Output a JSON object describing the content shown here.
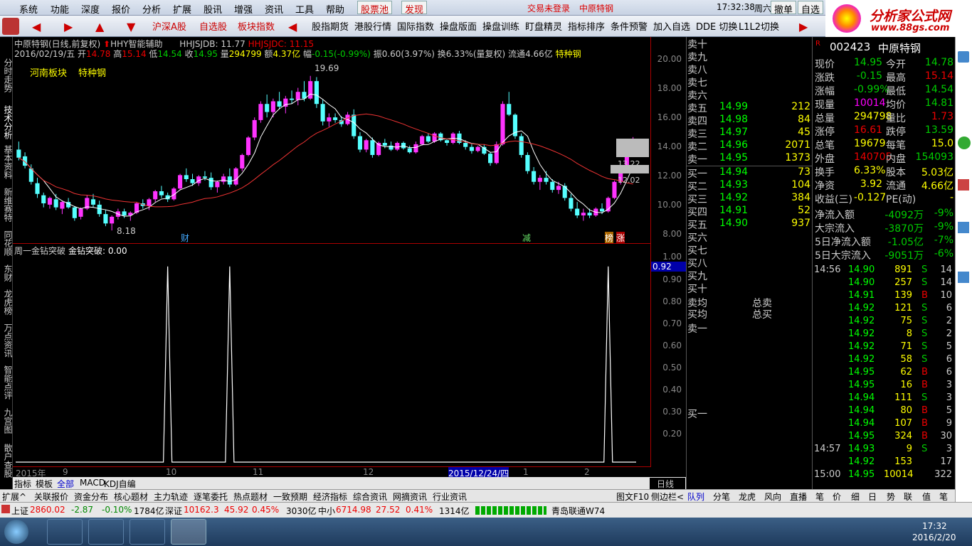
{
  "menu": {
    "items": [
      "系统",
      "功能",
      "深度",
      "报价",
      "分析",
      "扩展",
      "股讯",
      "增强",
      "资讯",
      "工具",
      "帮助"
    ],
    "stockpool": "股票池",
    "discover": "发现",
    "trade_status": "交易未登录",
    "stock_name": "中原特钢",
    "clock": "17:32:38",
    "weekday": "周六",
    "cancel": "撤单",
    "selfsel": "自选"
  },
  "toolbar": {
    "items": [
      "沪深A股",
      "自选股",
      "板块指数",
      "股指期货",
      "港股行情",
      "国际指数",
      "操盘版面",
      "操盘训练",
      "盯盘精灵",
      "指标排序",
      "条件预警",
      "加入自选",
      "DDE 切换",
      "L1L2切换"
    ]
  },
  "logo": {
    "title": "分析家公式网",
    "url": "www.88gs.com"
  },
  "leftbar": {
    "tabs": [
      "分时走势",
      "技术分析",
      "基本资料",
      "新维赛特",
      "同花顺",
      "东财",
      "龙虎榜",
      "万点资讯",
      "智能点评",
      "九宫图",
      "散户查股"
    ]
  },
  "chart": {
    "title": "中原特钢(日线,前复权)",
    "tool": "HHY智能辅助",
    "line1": "2016/02/19/五",
    "ohlc": {
      "open": "14.78",
      "high": "15.14",
      "low": "14.54",
      "close": "14.95",
      "vol": "294799",
      "amt": "4.37亿",
      "chg": "-0.15(-0.99%)",
      "amp": "0.60(3.97%)",
      "turnover": "6.33%(量复权)",
      "float": "4.66亿",
      "sector_short": "特种钢"
    },
    "hhjsjdb": "HHJSJDB: 11.77",
    "hhjsjdc": "HHJSJDC: 11.15",
    "board": "河南板块",
    "industry": "特种钢",
    "high_label": "19.69",
    "low_label": "8.18",
    "badge_cai": "财",
    "badge_jian": "减",
    "badge_bang": "榜",
    "badge_zhang": "涨",
    "price_box1": "13.22",
    "price_box2": "12.02",
    "price_axis": [
      "20.00",
      "18.00",
      "16.00",
      "14.00",
      "12.00",
      "10.00",
      "8.00"
    ]
  },
  "chart_data": {
    "type": "candlestick",
    "title": "中原特钢(日线,前复权)",
    "ylim": [
      7.5,
      21
    ],
    "candles": [
      [
        14.2,
        14.8,
        13.4,
        13.6
      ],
      [
        13.7,
        14.0,
        12.8,
        13.0
      ],
      [
        12.8,
        13.1,
        11.6,
        11.8
      ],
      [
        11.7,
        12.1,
        10.6,
        10.9
      ],
      [
        10.8,
        11.0,
        9.9,
        10.2
      ],
      [
        10.1,
        10.7,
        9.8,
        10.6
      ],
      [
        10.5,
        10.9,
        9.7,
        9.9
      ],
      [
        9.8,
        10.4,
        9.4,
        10.3
      ],
      [
        10.3,
        10.6,
        9.8,
        9.9
      ],
      [
        9.9,
        10.0,
        8.9,
        9.1
      ],
      [
        9.2,
        9.9,
        9.0,
        9.8
      ],
      [
        9.8,
        10.8,
        9.7,
        10.6
      ],
      [
        10.5,
        10.9,
        9.9,
        10.1
      ],
      [
        10.1,
        10.4,
        9.2,
        9.4
      ],
      [
        9.4,
        9.7,
        8.5,
        8.7
      ],
      [
        8.7,
        9.3,
        8.18,
        9.2
      ],
      [
        9.2,
        9.8,
        9.0,
        9.6
      ],
      [
        9.6,
        9.8,
        9.1,
        9.3
      ],
      [
        9.3,
        9.6,
        8.9,
        9.5
      ],
      [
        9.5,
        10.3,
        9.4,
        10.2
      ],
      [
        10.2,
        10.5,
        9.8,
        10.0
      ],
      [
        10.0,
        10.6,
        9.7,
        10.5
      ],
      [
        10.5,
        11.2,
        10.3,
        11.1
      ],
      [
        11.1,
        11.5,
        10.6,
        10.8
      ],
      [
        10.8,
        11.0,
        10.3,
        10.5
      ],
      [
        10.5,
        11.4,
        10.4,
        11.3
      ],
      [
        11.3,
        12.4,
        11.2,
        12.3
      ],
      [
        12.3,
        12.8,
        11.8,
        12.0
      ],
      [
        12.0,
        12.4,
        11.5,
        11.7
      ],
      [
        11.7,
        12.3,
        11.5,
        12.2
      ],
      [
        12.2,
        12.6,
        11.9,
        12.1
      ],
      [
        12.1,
        12.5,
        11.2,
        11.4
      ],
      [
        11.4,
        11.9,
        11.0,
        11.8
      ],
      [
        11.8,
        12.4,
        11.6,
        12.2
      ],
      [
        12.2,
        12.8,
        11.4,
        11.6
      ],
      [
        11.6,
        12.9,
        11.5,
        12.8
      ],
      [
        12.8,
        13.9,
        12.6,
        13.8
      ],
      [
        13.8,
        15.2,
        13.7,
        15.1
      ],
      [
        15.1,
        16.6,
        14.9,
        16.4
      ],
      [
        16.4,
        17.8,
        16.2,
        17.6
      ],
      [
        17.6,
        18.3,
        16.6,
        17.0
      ],
      [
        17.0,
        18.0,
        16.6,
        17.8
      ],
      [
        17.8,
        18.5,
        17.2,
        17.4
      ],
      [
        17.4,
        18.2,
        16.9,
        18.0
      ],
      [
        18.0,
        18.6,
        17.6,
        17.9
      ],
      [
        17.9,
        18.8,
        17.5,
        18.5
      ],
      [
        18.5,
        19.3,
        17.8,
        18.0
      ],
      [
        18.0,
        19.69,
        17.9,
        19.3
      ],
      [
        19.3,
        19.6,
        17.3,
        17.6
      ],
      [
        17.6,
        17.9,
        16.0,
        16.3
      ],
      [
        16.3,
        16.9,
        15.9,
        16.6
      ],
      [
        16.6,
        16.9,
        16.2,
        16.4
      ],
      [
        16.4,
        16.7,
        15.9,
        16.1
      ],
      [
        16.1,
        17.0,
        16.0,
        16.8
      ],
      [
        16.8,
        17.2,
        15.0,
        15.2
      ],
      [
        15.2,
        15.5,
        14.0,
        14.2
      ],
      [
        14.2,
        15.0,
        14.0,
        14.9
      ],
      [
        14.9,
        15.1,
        13.6,
        13.8
      ],
      [
        13.8,
        14.8,
        13.7,
        14.7
      ],
      [
        14.7,
        15.0,
        14.3,
        14.5
      ],
      [
        14.5,
        14.8,
        14.1,
        14.2
      ],
      [
        14.2,
        14.8,
        14.1,
        14.7
      ],
      [
        14.7,
        14.8,
        14.2,
        14.3
      ],
      [
        14.3,
        14.5,
        13.9,
        14.0
      ],
      [
        14.0,
        14.8,
        13.9,
        14.6
      ],
      [
        14.6,
        15.3,
        14.5,
        15.2
      ],
      [
        15.2,
        15.4,
        14.7,
        14.8
      ],
      [
        14.8,
        15.5,
        14.7,
        15.4
      ],
      [
        15.4,
        15.5,
        14.8,
        14.9
      ],
      [
        14.9,
        15.0,
        14.5,
        14.7
      ],
      [
        14.7,
        15.5,
        14.6,
        15.4
      ],
      [
        15.4,
        15.6,
        14.6,
        14.7
      ],
      [
        14.7,
        14.9,
        14.2,
        14.4
      ],
      [
        14.4,
        14.6,
        13.9,
        14.1
      ],
      [
        14.1,
        14.5,
        14.0,
        14.4
      ],
      [
        14.4,
        14.6,
        13.8,
        13.9
      ],
      [
        13.9,
        14.0,
        13.0,
        13.2
      ],
      [
        13.2,
        14.8,
        13.1,
        14.6
      ],
      [
        14.6,
        17.8,
        14.5,
        17.6
      ],
      [
        17.6,
        18.5,
        16.7,
        16.8
      ],
      [
        16.8,
        16.9,
        15.0,
        15.2
      ],
      [
        15.2,
        15.4,
        13.6,
        13.8
      ],
      [
        13.8,
        14.0,
        12.4,
        12.6
      ],
      [
        12.6,
        12.9,
        11.6,
        11.8
      ],
      [
        11.8,
        12.3,
        11.2,
        12.1
      ],
      [
        12.1,
        12.6,
        11.6,
        11.8
      ],
      [
        11.8,
        12.0,
        11.0,
        11.2
      ],
      [
        11.2,
        11.8,
        10.9,
        11.5
      ],
      [
        11.5,
        11.7,
        10.4,
        10.6
      ],
      [
        10.6,
        10.9,
        9.6,
        9.8
      ],
      [
        9.8,
        10.3,
        9.1,
        9.3
      ],
      [
        9.3,
        9.8,
        8.9,
        9.5
      ],
      [
        9.5,
        9.8,
        9.1,
        9.3
      ],
      [
        9.3,
        9.9,
        9.2,
        9.8
      ],
      [
        9.8,
        10.2,
        9.4,
        9.6
      ],
      [
        9.6,
        10.7,
        9.5,
        10.6
      ],
      [
        10.6,
        11.9,
        10.5,
        11.8
      ],
      [
        11.8,
        13.0,
        11.6,
        12.9
      ],
      [
        12.9,
        14.8,
        12.8,
        14.6
      ],
      [
        14.7,
        15.14,
        14.54,
        14.95
      ]
    ],
    "indicator": {
      "title": "周一金钻突破",
      "label": "金钻突破: 0.00",
      "ylim": [
        0,
        1.05
      ],
      "current": "0.92",
      "spikes": [
        {
          "index": 24,
          "value": 1.0
        },
        {
          "index": 34,
          "value": 1.0
        },
        {
          "index": 95,
          "value": 1.0
        }
      ],
      "axis": [
        "1.00",
        "0.90",
        "0.80",
        "0.70",
        "0.60",
        "0.50",
        "0.40",
        "0.30",
        "0.20"
      ]
    },
    "x_ticks": [
      "2015年",
      "9",
      "10",
      "11",
      "12",
      "2015/12/24/四",
      "1",
      "2"
    ]
  },
  "bottom_tabs": [
    "指标",
    "模板",
    "全部",
    "MACD",
    "KDJ自编"
  ],
  "period": "日线",
  "funcbar": {
    "items": [
      "扩展^",
      "关联报价",
      "资金分布",
      "核心题材",
      "主力轨迹",
      "逐笔委托",
      "热点题材",
      "一致预期",
      "经济指标",
      "综合资讯",
      "网摘资讯",
      "行业资讯"
    ],
    "right": [
      "图文F10",
      "侧边栏<"
    ]
  },
  "orderbook": {
    "sell": [
      {
        "l": "卖十",
        "p": "",
        "v": ""
      },
      {
        "l": "卖九",
        "p": "",
        "v": ""
      },
      {
        "l": "卖八",
        "p": "",
        "v": ""
      },
      {
        "l": "卖七",
        "p": "",
        "v": ""
      },
      {
        "l": "卖六",
        "p": "",
        "v": ""
      },
      {
        "l": "卖五",
        "p": "14.99",
        "v": "212"
      },
      {
        "l": "卖四",
        "p": "14.98",
        "v": "84"
      },
      {
        "l": "卖三",
        "p": "14.97",
        "v": "45"
      },
      {
        "l": "卖二",
        "p": "14.96",
        "v": "2071"
      },
      {
        "l": "卖一",
        "p": "14.95",
        "v": "1373"
      }
    ],
    "buy": [
      {
        "l": "买一",
        "p": "14.94",
        "v": "73"
      },
      {
        "l": "买二",
        "p": "14.93",
        "v": "104"
      },
      {
        "l": "买三",
        "p": "14.92",
        "v": "384"
      },
      {
        "l": "买四",
        "p": "14.91",
        "v": "52"
      },
      {
        "l": "买五",
        "p": "14.90",
        "v": "937"
      },
      {
        "l": "买六",
        "p": "",
        "v": ""
      },
      {
        "l": "买七",
        "p": "",
        "v": ""
      },
      {
        "l": "买八",
        "p": "",
        "v": ""
      },
      {
        "l": "买九",
        "p": "",
        "v": ""
      },
      {
        "l": "买十",
        "p": "",
        "v": ""
      }
    ],
    "avg_sell": "卖均",
    "avg_buy": "买均",
    "total_sell": "总卖",
    "total_buy": "总买",
    "q_sell1": "卖一",
    "q_buy1": "买一"
  },
  "quote": {
    "code": "002423",
    "name": "中原特钢",
    "rows": [
      {
        "k": "现价",
        "v": "14.95",
        "c": "green",
        "k2": "今开",
        "v2": "14.78",
        "c2": "green"
      },
      {
        "k": "涨跌",
        "v": "-0.15",
        "c": "green",
        "k2": "最高",
        "v2": "15.14",
        "c2": "red"
      },
      {
        "k": "涨幅",
        "v": "-0.99%",
        "c": "green",
        "k2": "最低",
        "v2": "14.54",
        "c2": "green"
      },
      {
        "k": "现量",
        "v": "10014",
        "c": "mag",
        "k2": "均价",
        "v2": "14.81",
        "c2": "green"
      },
      {
        "k": "总量",
        "v": "294798",
        "c": "yellow",
        "k2": "量比",
        "v2": "1.73",
        "c2": "red"
      },
      {
        "k": "涨停",
        "v": "16.61",
        "c": "red",
        "k2": "跌停",
        "v2": "13.59",
        "c2": "green"
      },
      {
        "k": "总笔",
        "v": "19679",
        "c": "yellow",
        "k2": "每笔",
        "v2": "15.0",
        "c2": "yellow"
      },
      {
        "k": "外盘",
        "v": "140705",
        "c": "red",
        "k2": "内盘",
        "v2": "154093",
        "c2": "green"
      },
      {
        "k": "换手",
        "v": "6.33%",
        "c": "yellow",
        "k2": "股本",
        "v2": "5.03亿",
        "c2": "yellow"
      },
      {
        "k": "净资",
        "v": "3.92",
        "c": "yellow",
        "k2": "流通",
        "v2": "4.66亿",
        "c2": "yellow"
      },
      {
        "k": "收益(三)",
        "v": "-0.127",
        "c": "yellow",
        "k2": "PE(动)",
        "v2": "-",
        "c2": "yellow"
      }
    ],
    "flows": [
      {
        "k": "净流入额",
        "v": "-4092万",
        "p": "-9%"
      },
      {
        "k": "大宗流入",
        "v": "-3870万",
        "p": "-9%"
      },
      {
        "k": "5日净流入额",
        "v": "-1.05亿",
        "p": "-7%"
      },
      {
        "k": "5日大宗流入",
        "v": "-9051万",
        "p": "-6%"
      }
    ],
    "ticks": [
      {
        "t": "14:56",
        "p": "14.90",
        "v": "891",
        "b": "S",
        "n": "14",
        "vc": "mag"
      },
      {
        "t": "",
        "p": "14.90",
        "v": "257",
        "b": "S",
        "n": "14",
        "vc": "yellow"
      },
      {
        "t": "",
        "p": "14.91",
        "v": "139",
        "b": "B",
        "n": "10",
        "vc": "yellow"
      },
      {
        "t": "",
        "p": "14.92",
        "v": "121",
        "b": "S",
        "n": "6",
        "vc": "yellow"
      },
      {
        "t": "",
        "p": "14.92",
        "v": "75",
        "b": "S",
        "n": "2",
        "vc": "yellow"
      },
      {
        "t": "",
        "p": "14.92",
        "v": "8",
        "b": "S",
        "n": "2",
        "vc": "yellow"
      },
      {
        "t": "",
        "p": "14.92",
        "v": "71",
        "b": "S",
        "n": "5",
        "vc": "yellow"
      },
      {
        "t": "",
        "p": "14.92",
        "v": "58",
        "b": "S",
        "n": "6",
        "vc": "yellow"
      },
      {
        "t": "",
        "p": "14.95",
        "v": "62",
        "b": "B",
        "n": "6",
        "vc": "yellow"
      },
      {
        "t": "",
        "p": "14.95",
        "v": "16",
        "b": "B",
        "n": "3",
        "vc": "yellow"
      },
      {
        "t": "",
        "p": "14.94",
        "v": "111",
        "b": "S",
        "n": "3",
        "vc": "yellow"
      },
      {
        "t": "",
        "p": "14.94",
        "v": "80",
        "b": "B",
        "n": "5",
        "vc": "yellow"
      },
      {
        "t": "",
        "p": "14.94",
        "v": "107",
        "b": "B",
        "n": "9",
        "vc": "yellow"
      },
      {
        "t": "",
        "p": "14.95",
        "v": "324",
        "b": "B",
        "n": "30",
        "vc": "yellow"
      },
      {
        "t": "14:57",
        "p": "14.93",
        "v": "9",
        "b": "S",
        "n": "3",
        "vc": "yellow"
      },
      {
        "t": "",
        "p": "14.92",
        "v": "153",
        "b": "",
        "n": "17",
        "vc": "yellow"
      },
      {
        "t": "15:00",
        "p": "14.95",
        "v": "10014",
        "b": "",
        "n": "322",
        "vc": "mag"
      }
    ]
  },
  "rtabs": [
    "队列",
    "分笔",
    "龙虎",
    "风向",
    "直播",
    "笔",
    "价",
    "细",
    "日",
    "势",
    "联",
    "值",
    "笔"
  ],
  "status": {
    "sh_label": "上证",
    "sh": "2860.02",
    "sh_chg": "-2.87",
    "sh_pct": "-0.10%",
    "sh_amt": "1784亿",
    "sz_label": "深证",
    "sz": "10162.3",
    "sz_chg": "45.92",
    "sz_pct": "0.45%",
    "sz_amt": "3030亿",
    "zx_label": "中小",
    "zx": "6714.98",
    "zx_chg": "27.52",
    "zx_pct": "0.41%",
    "zx_amt": "1314亿",
    "server": "青岛联通W74"
  },
  "taskbar": {
    "time": "17:32",
    "date": "2016/2/20"
  }
}
